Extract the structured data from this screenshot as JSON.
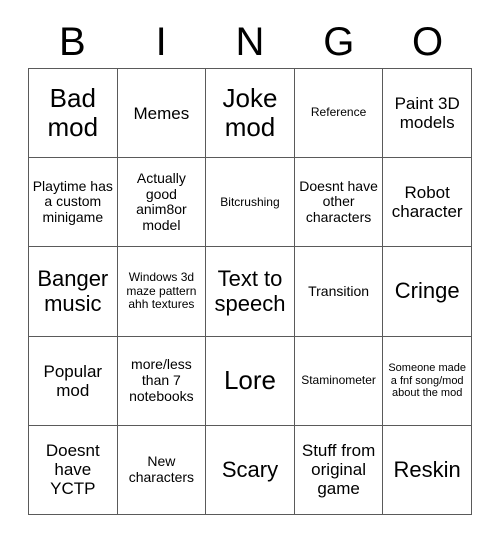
{
  "card": {
    "header_letters": [
      "B",
      "I",
      "N",
      "G",
      "O"
    ],
    "rows": [
      [
        {
          "text": "Bad mod",
          "size": "fs-xl"
        },
        {
          "text": "Memes",
          "size": "fs-md"
        },
        {
          "text": "Joke mod",
          "size": "fs-xl"
        },
        {
          "text": "Reference",
          "size": "fs-xs"
        },
        {
          "text": "Paint 3D models",
          "size": "fs-md"
        }
      ],
      [
        {
          "text": "Playtime has a custom minigame",
          "size": "fs-sm"
        },
        {
          "text": "Actually good anim8or model",
          "size": "fs-sm"
        },
        {
          "text": "Bitcrushing",
          "size": "fs-xs"
        },
        {
          "text": "Doesnt have other characters",
          "size": "fs-sm"
        },
        {
          "text": "Robot character",
          "size": "fs-md"
        }
      ],
      [
        {
          "text": "Banger music",
          "size": "fs-lg"
        },
        {
          "text": "Windows 3d maze pattern ahh textures",
          "size": "fs-xs"
        },
        {
          "text": "Text to speech",
          "size": "fs-lg"
        },
        {
          "text": "Transition",
          "size": "fs-sm"
        },
        {
          "text": "Cringe",
          "size": "fs-lg"
        }
      ],
      [
        {
          "text": "Popular mod",
          "size": "fs-md"
        },
        {
          "text": "more/less than 7 notebooks",
          "size": "fs-sm"
        },
        {
          "text": "Lore",
          "size": "fs-xl"
        },
        {
          "text": "Staminometer",
          "size": "fs-xs"
        },
        {
          "text": "Someone made a fnf song/mod about the mod",
          "size": "fs-xxs"
        }
      ],
      [
        {
          "text": "Doesnt have YCTP",
          "size": "fs-md"
        },
        {
          "text": "New characters",
          "size": "fs-sm"
        },
        {
          "text": "Scary",
          "size": "fs-lg"
        },
        {
          "text": "Stuff from original game",
          "size": "fs-md"
        },
        {
          "text": "Reskin",
          "size": "fs-lg"
        }
      ]
    ]
  },
  "colors": {
    "background": "#ffffff",
    "text": "#000000",
    "border": "#5a5a5a"
  }
}
